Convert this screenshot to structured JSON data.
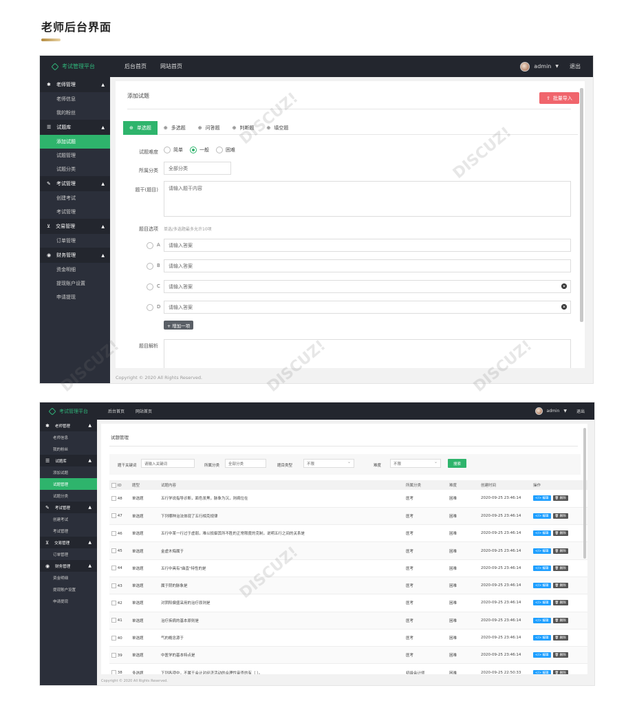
{
  "heading": "老师后台界面",
  "app": {
    "brand": "考试管理平台",
    "topnav": [
      "后台首页",
      "网站首页"
    ],
    "user": "admin",
    "logout": "退出",
    "footer": "Copyright © 2020 All Rights Reserved."
  },
  "sidebar": {
    "groups": [
      {
        "label": "老师管理",
        "icon": "gear-icon",
        "items": [
          "老师信息",
          "我的粉丝"
        ]
      },
      {
        "label": "试题库",
        "icon": "list-icon",
        "items": [
          "添加试题",
          "试题管理",
          "试题分类"
        ]
      },
      {
        "label": "考试管理",
        "icon": "exam-icon",
        "items": [
          "创建考试",
          "考试管理"
        ]
      },
      {
        "label": "交易管理",
        "icon": "cart-icon",
        "items": [
          "订单管理"
        ]
      },
      {
        "label": "财务管理",
        "icon": "finance-icon",
        "items": [
          "资金明细",
          "提现账户设置",
          "申请提现"
        ]
      }
    ]
  },
  "add_form": {
    "title": "添加试题",
    "import_button": "批量导入",
    "tabs": [
      "单选题",
      "多选题",
      "问答题",
      "判断题",
      "填空题"
    ],
    "difficulty_label": "试题难度",
    "difficulty_options": [
      "简单",
      "一般",
      "困难"
    ],
    "category_label": "所属分类",
    "category_value": "全部分类",
    "stem_label": "题干(题目)",
    "stem_placeholder": "请输入题干内容",
    "options_label": "题目选项",
    "options_hint": "单选/多选题最多允许10项",
    "options": [
      {
        "letter": "A",
        "placeholder": "请输入答案"
      },
      {
        "letter": "B",
        "placeholder": "请输入答案"
      },
      {
        "letter": "C",
        "placeholder": "请输入答案"
      },
      {
        "letter": "D",
        "placeholder": "请输入答案"
      }
    ],
    "add_option": "+ 增加一项",
    "analysis_label": "题目解析"
  },
  "list": {
    "title": "试题管理",
    "filter": {
      "keyword_label": "题干关键词",
      "keyword_placeholder": "请输入关键词",
      "category_label": "所属分类",
      "category_value": "全部分类",
      "type_label": "题目类型",
      "type_value": "不限",
      "difficulty_label": "难度",
      "difficulty_value": "不限",
      "search_button": "搜索"
    },
    "columns": [
      "ID",
      "题型",
      "试题内容",
      "所属分类",
      "难度",
      "创建时间",
      "操作"
    ],
    "edit_label": "编辑",
    "delete_label": "删除",
    "rows": [
      {
        "id": "48",
        "type": "单选题",
        "content": "五行学说指导诊断，面色发黑，脉象为沉，则病位在",
        "category": "医考",
        "difficulty": "困难",
        "created": "2020-09-25 23:46:14"
      },
      {
        "id": "47",
        "type": "单选题",
        "content": "下列哪种治法体现了五行相克规律",
        "category": "医考",
        "difficulty": "困难",
        "created": "2020-09-25 23:46:14"
      },
      {
        "id": "46",
        "type": "单选题",
        "content": "五行中某一行过于虚弱，难以抵御其所不胜的正常限度的克制，说明五行之间的关系是",
        "category": "医考",
        "difficulty": "困难",
        "created": "2020-09-25 23:46:14"
      },
      {
        "id": "45",
        "type": "单选题",
        "content": "金虚木侮属于",
        "category": "医考",
        "difficulty": "困难",
        "created": "2020-09-25 23:46:14"
      },
      {
        "id": "44",
        "type": "单选题",
        "content": "五行中具有\"曲直\"特性的是",
        "category": "医考",
        "difficulty": "困难",
        "created": "2020-09-25 23:46:14"
      },
      {
        "id": "43",
        "type": "单选题",
        "content": "属于阴的脉象是",
        "category": "医考",
        "difficulty": "困难",
        "created": "2020-09-25 23:46:14"
      },
      {
        "id": "42",
        "type": "单选题",
        "content": "对阴阳偏盛采用的治疗原则是",
        "category": "医考",
        "difficulty": "困难",
        "created": "2020-09-25 23:46:14"
      },
      {
        "id": "41",
        "type": "单选题",
        "content": "治疗疾病的基本原则是",
        "category": "医考",
        "difficulty": "困难",
        "created": "2020-09-25 23:46:14"
      },
      {
        "id": "40",
        "type": "单选题",
        "content": "气的概念源于",
        "category": "医考",
        "difficulty": "困难",
        "created": "2020-09-25 23:46:14"
      },
      {
        "id": "39",
        "type": "单选题",
        "content": "中医学的基本特点是",
        "category": "医考",
        "difficulty": "困难",
        "created": "2020-09-25 23:46:14"
      },
      {
        "id": "38",
        "type": "多选题",
        "content": "下列各项中，不属于会计对经济活动的合理性审查的有（    ）。",
        "category": "初级会计师",
        "difficulty": "困难",
        "created": "2020-09-25 22:50:33"
      }
    ]
  },
  "watermark": [
    "DISCUZ!应用中心",
    "addon.dismall.com",
    "贰道"
  ],
  "colors": {
    "accent": "#2eb46c",
    "danger": "#f0656c",
    "edit": "#1e9fff",
    "topbar": "#23262e",
    "sidebar": "#2b2f3a"
  }
}
